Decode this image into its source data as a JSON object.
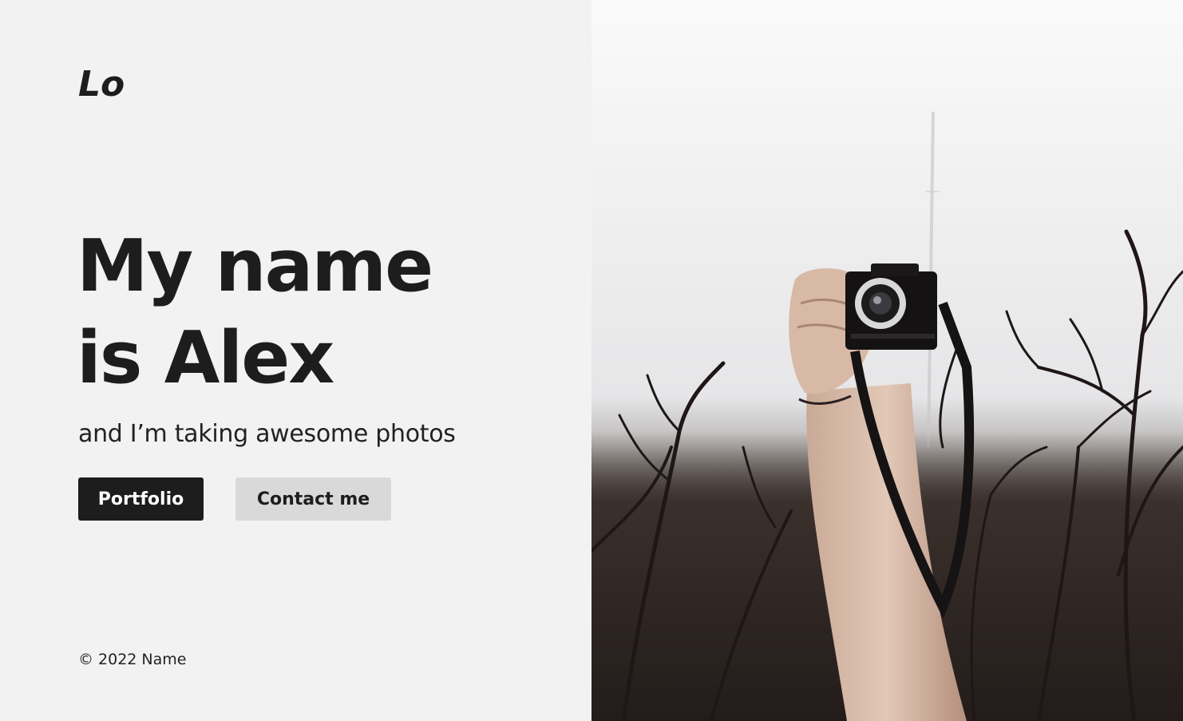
{
  "logo": {
    "text": "Lo"
  },
  "hero": {
    "headline_line1": "My name",
    "headline_line2": "is Alex",
    "tagline": "and I’m taking awesome photos"
  },
  "buttons": {
    "portfolio": "Portfolio",
    "contact": "Contact me"
  },
  "footer": {
    "copyright": "© 2022 Name"
  },
  "photo": {
    "subject": "hand-holding-camera-among-bare-branches"
  },
  "colors": {
    "text": "#1d1d1d",
    "background": "#f2f2f2",
    "primary_button": "#1d1d1d",
    "secondary_button": "#d9d9d9"
  }
}
